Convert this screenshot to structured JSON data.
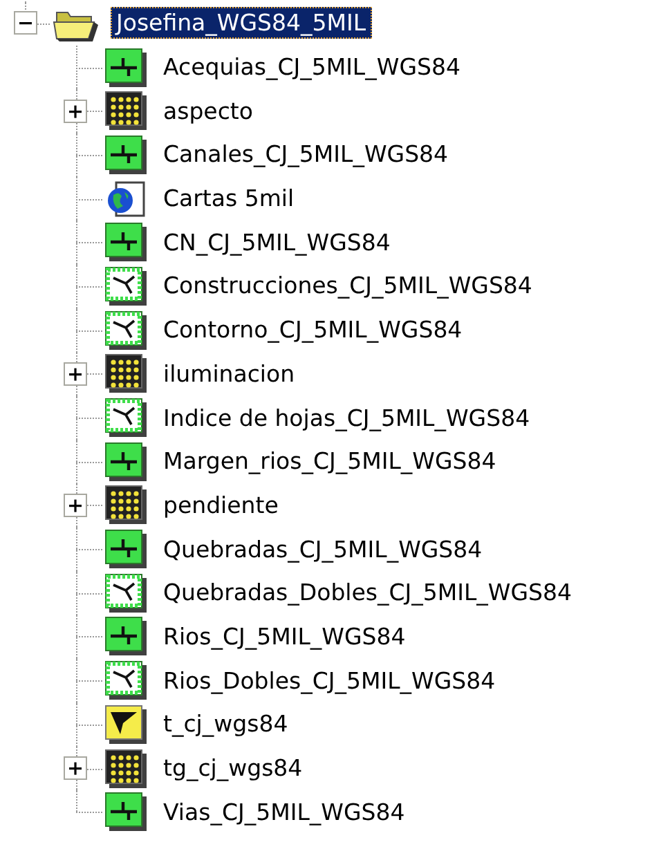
{
  "tree": {
    "label": "Josefina_WGS84_5MIL",
    "expanded": true,
    "selected": true,
    "children": [
      {
        "label": "Acequias_CJ_5MIL_WGS84",
        "kind": "line",
        "selected": false
      },
      {
        "label": "aspecto",
        "kind": "raster",
        "expanded": false,
        "selected": false
      },
      {
        "label": "Canales_CJ_5MIL_WGS84",
        "kind": "line",
        "selected": false
      },
      {
        "label": "Cartas 5mil",
        "kind": "map",
        "selected": false
      },
      {
        "label": "CN_CJ_5MIL_WGS84",
        "kind": "line",
        "selected": false
      },
      {
        "label": "Construcciones_CJ_5MIL_WGS84",
        "kind": "polygon",
        "selected": false
      },
      {
        "label": "Contorno_CJ_5MIL_WGS84",
        "kind": "polygon",
        "selected": false
      },
      {
        "label": "iluminacion",
        "kind": "raster",
        "expanded": false,
        "selected": false
      },
      {
        "label": "Indice de hojas_CJ_5MIL_WGS84",
        "kind": "polygon",
        "selected": false
      },
      {
        "label": "Margen_rios_CJ_5MIL_WGS84",
        "kind": "line",
        "selected": false
      },
      {
        "label": "pendiente",
        "kind": "raster",
        "expanded": false,
        "selected": false
      },
      {
        "label": "Quebradas_CJ_5MIL_WGS84",
        "kind": "line",
        "selected": false
      },
      {
        "label": "Quebradas_Dobles_CJ_5MIL_WGS84",
        "kind": "polygon",
        "selected": false
      },
      {
        "label": "Rios_CJ_5MIL_WGS84",
        "kind": "line",
        "selected": false
      },
      {
        "label": "Rios_Dobles_CJ_5MIL_WGS84",
        "kind": "polygon",
        "selected": false
      },
      {
        "label": "t_cj_wgs84",
        "kind": "tin",
        "selected": false
      },
      {
        "label": "tg_cj_wgs84",
        "kind": "raster",
        "expanded": false,
        "selected": false
      },
      {
        "label": "Vias_CJ_5MIL_WGS84",
        "kind": "line",
        "selected": false
      }
    ]
  }
}
